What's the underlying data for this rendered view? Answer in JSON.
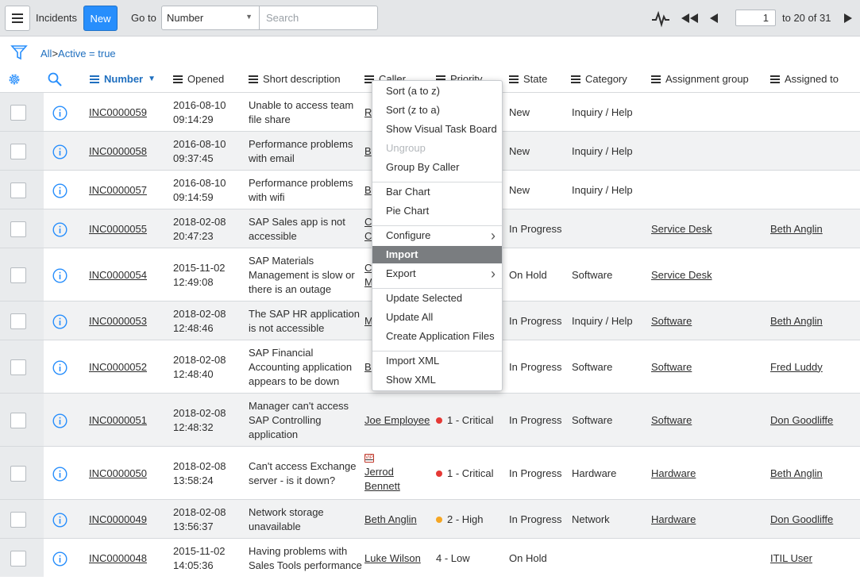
{
  "topbar": {
    "menu_icon": "hamburger-icon",
    "title": "Incidents",
    "new_label": "New",
    "goto_label": "Go to",
    "goto_field": "Number",
    "search_placeholder": "Search",
    "page_value": "1",
    "range_text": "to 20 of 31"
  },
  "breadcrumb": {
    "all": "All",
    "sep": ">",
    "condition": "Active = true"
  },
  "columns": [
    "Number",
    "Opened",
    "Short description",
    "Caller",
    "Priority",
    "State",
    "Category",
    "Assignment group",
    "Assigned to"
  ],
  "colors": {
    "accent": "#278efc",
    "link": "#1f6fbf",
    "critical": "#e53935",
    "high": "#f5a623"
  },
  "rows": [
    {
      "number": "INC0000059",
      "opened1": "2016-08-10",
      "opened2": "09:14:29",
      "desc": [
        "Unable to access team",
        "file share"
      ],
      "caller": [
        "R"
      ],
      "priority": "",
      "state": "New",
      "category": "Inquiry / Help",
      "group": "",
      "assigned": ""
    },
    {
      "number": "INC0000058",
      "opened1": "2016-08-10",
      "opened2": "09:37:45",
      "desc": [
        "Performance problems",
        "with email"
      ],
      "caller": [
        "B"
      ],
      "priority": "",
      "state": "New",
      "category": "Inquiry / Help",
      "group": "",
      "assigned": ""
    },
    {
      "number": "INC0000057",
      "opened1": "2016-08-10",
      "opened2": "09:14:59",
      "desc": [
        "Performance problems",
        "with wifi"
      ],
      "caller": [
        "B"
      ],
      "priority": "",
      "state": "New",
      "category": "Inquiry / Help",
      "group": "",
      "assigned": ""
    },
    {
      "number": "INC0000055",
      "opened1": "2018-02-08",
      "opened2": "20:47:23",
      "desc": [
        "SAP Sales app is not",
        "accessible"
      ],
      "caller": [
        "C",
        "C"
      ],
      "priority": "",
      "state": "In Progress",
      "category": "",
      "group": "Service Desk",
      "assigned": "Beth Anglin"
    },
    {
      "number": "INC0000054",
      "opened1": "2015-11-02",
      "opened2": "12:49:08",
      "desc": [
        "SAP Materials",
        "Management is slow or",
        "there is an outage"
      ],
      "caller": [
        "C",
        "M"
      ],
      "priority": "",
      "state": "On Hold",
      "category": "Software",
      "group": "Service Desk",
      "assigned": ""
    },
    {
      "number": "INC0000053",
      "opened1": "2018-02-08",
      "opened2": "12:48:46",
      "desc": [
        "The SAP HR application",
        "is not accessible"
      ],
      "caller": [
        "M"
      ],
      "priority": "",
      "state": "In Progress",
      "category": "Inquiry / Help",
      "group": "Software",
      "assigned": "Beth Anglin"
    },
    {
      "number": "INC0000052",
      "opened1": "2018-02-08",
      "opened2": "12:48:40",
      "desc": [
        "SAP Financial",
        "Accounting application",
        "appears to be down"
      ],
      "caller": [
        "B"
      ],
      "priority": "",
      "state": "In Progress",
      "category": "Software",
      "group": "Software",
      "assigned": "Fred Luddy"
    },
    {
      "number": "INC0000051",
      "opened1": "2018-02-08",
      "opened2": "12:48:32",
      "desc": [
        "Manager can't access",
        "SAP Controlling",
        "application"
      ],
      "caller": [
        "Joe Employee"
      ],
      "priority": "1 - Critical",
      "state": "In Progress",
      "category": "Software",
      "group": "Software",
      "assigned": "Don Goodliffe"
    },
    {
      "number": "INC0000050",
      "opened1": "2018-02-08",
      "opened2": "13:58:24",
      "desc": [
        "Can't access Exchange",
        "server - is it down?"
      ],
      "caller": [
        "Jerrod",
        "Bennett"
      ],
      "vip": true,
      "priority": "1 - Critical",
      "state": "In Progress",
      "category": "Hardware",
      "group": "Hardware",
      "assigned": "Beth Anglin"
    },
    {
      "number": "INC0000049",
      "opened1": "2018-02-08",
      "opened2": "13:56:37",
      "desc": [
        "Network storage",
        "unavailable"
      ],
      "caller": [
        "Beth Anglin"
      ],
      "priority": "2 - High",
      "state": "In Progress",
      "category": "Network",
      "group": "Hardware",
      "assigned": "Don Goodliffe"
    },
    {
      "number": "INC0000048",
      "opened1": "2015-11-02",
      "opened2": "14:05:36",
      "desc": [
        "Having problems with",
        "Sales Tools performance"
      ],
      "caller": [
        "Luke Wilson"
      ],
      "priority": "4 - Low",
      "state": "On Hold",
      "category": "",
      "group": "",
      "assigned": "ITIL User"
    }
  ],
  "context_menu": {
    "items": [
      {
        "label": "Sort (a to z)"
      },
      {
        "label": "Sort (z to a)"
      },
      {
        "label": "Show Visual Task Board"
      },
      {
        "label": "Ungroup",
        "disabled": true
      },
      {
        "label": "Group By Caller"
      },
      {
        "label": "Bar Chart"
      },
      {
        "label": "Pie Chart"
      },
      {
        "label": "Configure",
        "submenu": true
      },
      {
        "label": "Import",
        "highlighted": true
      },
      {
        "label": "Export",
        "submenu": true
      },
      {
        "label": "Update Selected"
      },
      {
        "label": "Update All"
      },
      {
        "label": "Create Application Files"
      },
      {
        "label": "Import XML"
      },
      {
        "label": "Show XML"
      }
    ]
  }
}
